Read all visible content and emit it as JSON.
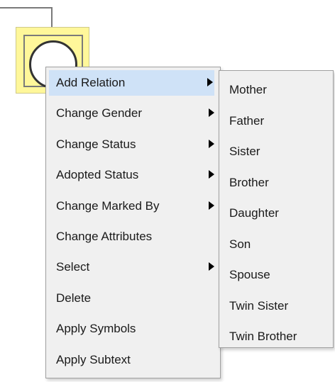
{
  "context_menu": {
    "items": [
      {
        "label": "Add Relation",
        "has_submenu": true,
        "highlighted": true
      },
      {
        "label": "Change Gender",
        "has_submenu": true
      },
      {
        "label": "Change Status",
        "has_submenu": true
      },
      {
        "label": "Adopted Status",
        "has_submenu": true
      },
      {
        "label": "Change Marked By",
        "has_submenu": true
      },
      {
        "label": "Change Attributes",
        "has_submenu": false
      },
      {
        "label": "Select",
        "has_submenu": true
      },
      {
        "label": "Delete",
        "has_submenu": false
      },
      {
        "label": "Apply Symbols",
        "has_submenu": false
      },
      {
        "label": "Apply Subtext",
        "has_submenu": false
      }
    ]
  },
  "submenu": {
    "items": [
      {
        "label": "Mother"
      },
      {
        "label": "Father"
      },
      {
        "label": "Sister"
      },
      {
        "label": "Brother"
      },
      {
        "label": "Daughter"
      },
      {
        "label": "Son"
      },
      {
        "label": "Spouse"
      },
      {
        "label": "Twin Sister"
      },
      {
        "label": "Twin Brother"
      }
    ]
  },
  "colors": {
    "node_fill": "#fff79a",
    "highlight": "#cfe2f7",
    "menu_bg": "#f0f0f0"
  }
}
